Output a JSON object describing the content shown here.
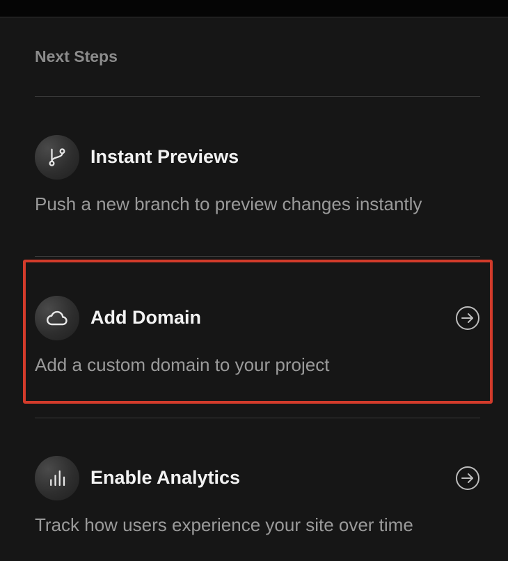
{
  "section": {
    "title": "Next Steps"
  },
  "steps": [
    {
      "title": "Instant Previews",
      "description": "Push a new branch to preview changes instantly",
      "icon": "git-branch-icon",
      "has_arrow": false
    },
    {
      "title": "Add Domain",
      "description": "Add a custom domain to your project",
      "icon": "cloud-icon",
      "has_arrow": true
    },
    {
      "title": "Enable Analytics",
      "description": "Track how users experience your site over time",
      "icon": "bar-chart-icon",
      "has_arrow": true
    }
  ],
  "colors": {
    "background": "#161616",
    "highlight": "#d23b2b",
    "title": "#f2f2f2",
    "description": "#9a9a9a"
  }
}
